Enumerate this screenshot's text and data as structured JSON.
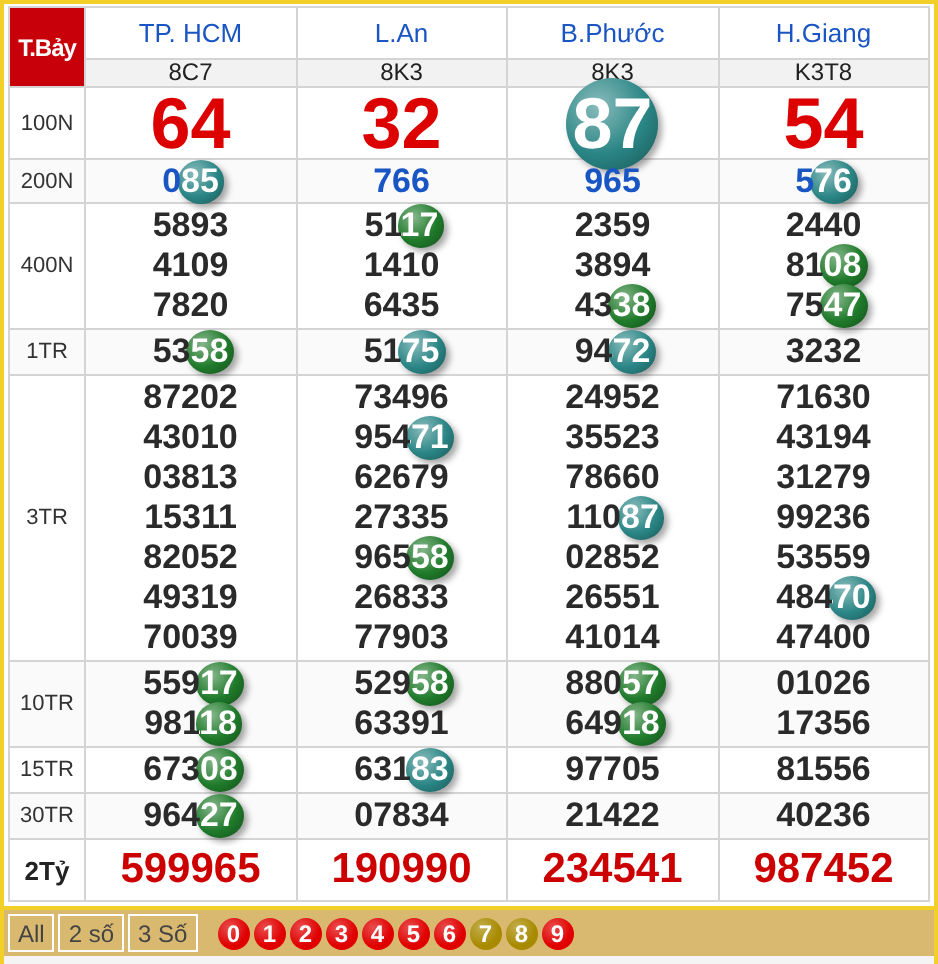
{
  "corner_label": "T.Bảy",
  "provinces": [
    {
      "name": "TP. HCM",
      "code": "8C7"
    },
    {
      "name": "L.An",
      "code": "8K3"
    },
    {
      "name": "B.Phước",
      "code": "8K3"
    },
    {
      "name": "H.Giang",
      "code": "K3T8"
    }
  ],
  "rows": [
    {
      "label": "100N",
      "kind": "special",
      "cells": [
        [
          {
            "text": "64"
          }
        ],
        [
          {
            "text": "32"
          }
        ],
        [
          {
            "text": "87",
            "color": "#2a8585"
          }
        ],
        [
          {
            "text": "54"
          }
        ]
      ]
    },
    {
      "label": "200N",
      "kind": "blue",
      "cells": [
        [
          {
            "text": "085",
            "color": "#2a8585"
          }
        ],
        [
          {
            "text": "766"
          }
        ],
        [
          {
            "text": "965"
          }
        ],
        [
          {
            "text": "576",
            "color": "#2a8585"
          }
        ]
      ]
    },
    {
      "label": "400N",
      "kind": "normal",
      "cells": [
        [
          {
            "text": "5893"
          },
          {
            "text": "4109"
          },
          {
            "text": "7820"
          }
        ],
        [
          {
            "text": "5117",
            "color": "#1f7a2a"
          },
          {
            "text": "1410"
          },
          {
            "text": "6435"
          }
        ],
        [
          {
            "text": "2359"
          },
          {
            "text": "3894"
          },
          {
            "text": "4338",
            "color": "#1f7a2a"
          }
        ],
        [
          {
            "text": "2440"
          },
          {
            "text": "8108",
            "color": "#1f7a2a"
          },
          {
            "text": "7547",
            "color": "#1f7a2a"
          }
        ]
      ]
    },
    {
      "label": "1TR",
      "kind": "normal",
      "cells": [
        [
          {
            "text": "5358",
            "color": "#1f7a2a"
          }
        ],
        [
          {
            "text": "5175",
            "color": "#2a8585"
          }
        ],
        [
          {
            "text": "9472",
            "color": "#2a8585"
          }
        ],
        [
          {
            "text": "3232"
          }
        ]
      ]
    },
    {
      "label": "3TR",
      "kind": "normal",
      "cells": [
        [
          {
            "text": "87202"
          },
          {
            "text": "43010"
          },
          {
            "text": "03813"
          },
          {
            "text": "15311"
          },
          {
            "text": "82052"
          },
          {
            "text": "49319"
          },
          {
            "text": "70039"
          }
        ],
        [
          {
            "text": "73496"
          },
          {
            "text": "95471",
            "color": "#2a8585"
          },
          {
            "text": "62679"
          },
          {
            "text": "27335"
          },
          {
            "text": "96558",
            "color": "#1f7a2a"
          },
          {
            "text": "26833"
          },
          {
            "text": "77903"
          }
        ],
        [
          {
            "text": "24952"
          },
          {
            "text": "35523"
          },
          {
            "text": "78660"
          },
          {
            "text": "11087",
            "color": "#2a8585"
          },
          {
            "text": "02852"
          },
          {
            "text": "26551"
          },
          {
            "text": "41014"
          }
        ],
        [
          {
            "text": "71630"
          },
          {
            "text": "43194"
          },
          {
            "text": "31279"
          },
          {
            "text": "99236"
          },
          {
            "text": "53559"
          },
          {
            "text": "48470",
            "color": "#2a8585"
          },
          {
            "text": "47400"
          }
        ]
      ]
    },
    {
      "label": "10TR",
      "kind": "normal",
      "cells": [
        [
          {
            "text": "55917",
            "color": "#1f7a2a"
          },
          {
            "text": "98118",
            "color": "#1f7a2a"
          }
        ],
        [
          {
            "text": "52958",
            "color": "#1f7a2a"
          },
          {
            "text": "63391"
          }
        ],
        [
          {
            "text": "88057",
            "color": "#1f7a2a"
          },
          {
            "text": "64918",
            "color": "#1f7a2a"
          }
        ],
        [
          {
            "text": "01026"
          },
          {
            "text": "17356"
          }
        ]
      ]
    },
    {
      "label": "15TR",
      "kind": "normal",
      "cells": [
        [
          {
            "text": "67308",
            "color": "#1f7a2a"
          }
        ],
        [
          {
            "text": "63183",
            "color": "#2a8585"
          }
        ],
        [
          {
            "text": "97705"
          }
        ],
        [
          {
            "text": "81556"
          }
        ]
      ]
    },
    {
      "label": "30TR",
      "kind": "normal",
      "cells": [
        [
          {
            "text": "96427",
            "color": "#1f7a2a"
          }
        ],
        [
          {
            "text": "07834"
          }
        ],
        [
          {
            "text": "21422"
          }
        ],
        [
          {
            "text": "40236"
          }
        ]
      ]
    },
    {
      "label": "2Tỷ",
      "kind": "jackpot",
      "cells": [
        [
          {
            "text": "599965"
          }
        ],
        [
          {
            "text": "190990"
          }
        ],
        [
          {
            "text": "234541"
          }
        ],
        [
          {
            "text": "987452"
          }
        ]
      ]
    }
  ],
  "filters": [
    "All",
    "2 số",
    "3 Số"
  ],
  "digits": [
    {
      "label": "0",
      "selected": false
    },
    {
      "label": "1",
      "selected": false
    },
    {
      "label": "2",
      "selected": false
    },
    {
      "label": "3",
      "selected": false
    },
    {
      "label": "4",
      "selected": false
    },
    {
      "label": "5",
      "selected": false
    },
    {
      "label": "6",
      "selected": false
    },
    {
      "label": "7",
      "selected": true
    },
    {
      "label": "8",
      "selected": true
    },
    {
      "label": "9",
      "selected": false
    }
  ]
}
